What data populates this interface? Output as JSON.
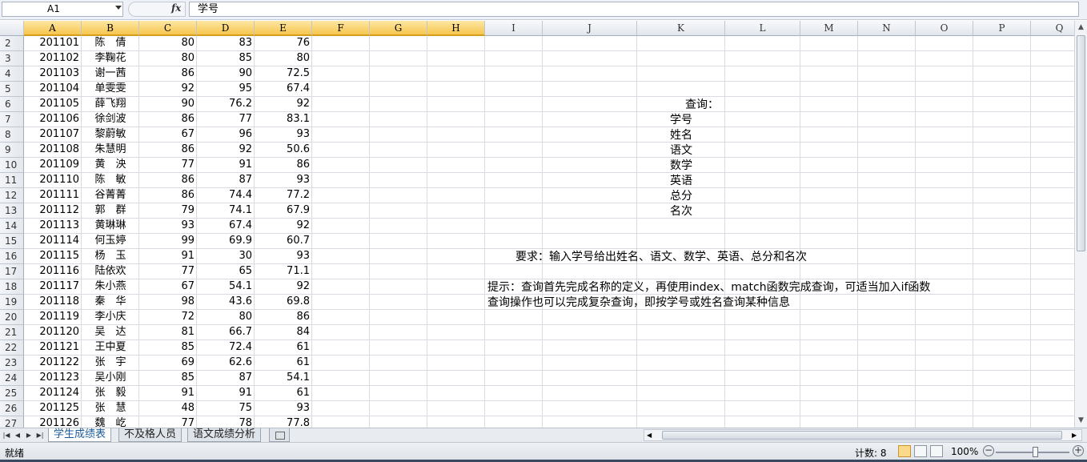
{
  "formula_bar": {
    "cell_ref": "A1",
    "fx_label": "fx",
    "content": "学号"
  },
  "columns": [
    "A",
    "B",
    "C",
    "D",
    "E",
    "F",
    "G",
    "H",
    "I",
    "J",
    "K",
    "L",
    "M",
    "N",
    "O",
    "P",
    "Q"
  ],
  "rows": [
    {
      "n": "2",
      "id": "201101",
      "name": "陈　倩",
      "c": "80",
      "d": "83",
      "e": "76"
    },
    {
      "n": "3",
      "id": "201102",
      "name": "李鞠花",
      "c": "80",
      "d": "85",
      "e": "80"
    },
    {
      "n": "4",
      "id": "201103",
      "name": "谢一茜",
      "c": "86",
      "d": "90",
      "e": "72.5"
    },
    {
      "n": "5",
      "id": "201104",
      "name": "单雯雯",
      "c": "92",
      "d": "95",
      "e": "67.4"
    },
    {
      "n": "6",
      "id": "201105",
      "name": "薛飞翔",
      "c": "90",
      "d": "76.2",
      "e": "92"
    },
    {
      "n": "7",
      "id": "201106",
      "name": "徐剑波",
      "c": "86",
      "d": "77",
      "e": "83.1"
    },
    {
      "n": "8",
      "id": "201107",
      "name": "黎蔚敏",
      "c": "67",
      "d": "96",
      "e": "93"
    },
    {
      "n": "9",
      "id": "201108",
      "name": "朱慧明",
      "c": "86",
      "d": "92",
      "e": "50.6"
    },
    {
      "n": "10",
      "id": "201109",
      "name": "黄　泱",
      "c": "77",
      "d": "91",
      "e": "86"
    },
    {
      "n": "11",
      "id": "201110",
      "name": "陈　敏",
      "c": "86",
      "d": "87",
      "e": "93"
    },
    {
      "n": "12",
      "id": "201111",
      "name": "谷菁菁",
      "c": "86",
      "d": "74.4",
      "e": "77.2"
    },
    {
      "n": "13",
      "id": "201112",
      "name": "郭　群",
      "c": "79",
      "d": "74.1",
      "e": "67.9"
    },
    {
      "n": "14",
      "id": "201113",
      "name": "黄琳琳",
      "c": "93",
      "d": "67.4",
      "e": "92"
    },
    {
      "n": "15",
      "id": "201114",
      "name": "何玉婷",
      "c": "99",
      "d": "69.9",
      "e": "60.7"
    },
    {
      "n": "16",
      "id": "201115",
      "name": "杨　玉",
      "c": "91",
      "d": "30",
      "e": "93"
    },
    {
      "n": "17",
      "id": "201116",
      "name": "陆依欢",
      "c": "77",
      "d": "65",
      "e": "71.1"
    },
    {
      "n": "18",
      "id": "201117",
      "name": "朱小燕",
      "c": "67",
      "d": "54.1",
      "e": "92"
    },
    {
      "n": "19",
      "id": "201118",
      "name": "秦　华",
      "c": "98",
      "d": "43.6",
      "e": "69.8"
    },
    {
      "n": "20",
      "id": "201119",
      "name": "李小庆",
      "c": "72",
      "d": "80",
      "e": "86"
    },
    {
      "n": "21",
      "id": "201120",
      "name": "吴　达",
      "c": "81",
      "d": "66.7",
      "e": "84"
    },
    {
      "n": "22",
      "id": "201121",
      "name": "王中夏",
      "c": "85",
      "d": "72.4",
      "e": "61"
    },
    {
      "n": "23",
      "id": "201122",
      "name": "张　宇",
      "c": "69",
      "d": "62.6",
      "e": "61"
    },
    {
      "n": "24",
      "id": "201123",
      "name": "吴小刚",
      "c": "85",
      "d": "87",
      "e": "54.1"
    },
    {
      "n": "25",
      "id": "201124",
      "name": "张　毅",
      "c": "91",
      "d": "91",
      "e": "61"
    },
    {
      "n": "26",
      "id": "201125",
      "name": "张　慧",
      "c": "48",
      "d": "75",
      "e": "93"
    },
    {
      "n": "27",
      "id": "201126",
      "name": "魏　屹",
      "c": "77",
      "d": "78",
      "e": "77.8"
    }
  ],
  "query_panel": {
    "title": "查询：",
    "labels": [
      "学号",
      "姓名",
      "语文",
      "数学",
      "英语",
      "总分",
      "名次"
    ]
  },
  "requirement": "要求：输入学号给出姓名、语文、数学、英语、总分和名次",
  "hint_line1": "提示：查询首先完成名称的定义，再使用index、match函数完成查询，可适当加入if函数",
  "hint_line2": "查询操作也可以完成复杂查询，即按学号或姓名查询某种信息",
  "sheet_tabs": [
    "学生成绩表",
    "不及格人员",
    "语文成绩分析"
  ],
  "active_tab": 0,
  "status": {
    "ready": "就绪",
    "count": "计数: 8",
    "zoom": "100%"
  },
  "colors": {
    "selected_header": "#f7c64f",
    "grid_line": "#d8dce2",
    "active_tab_text": "#1a5c9a"
  }
}
